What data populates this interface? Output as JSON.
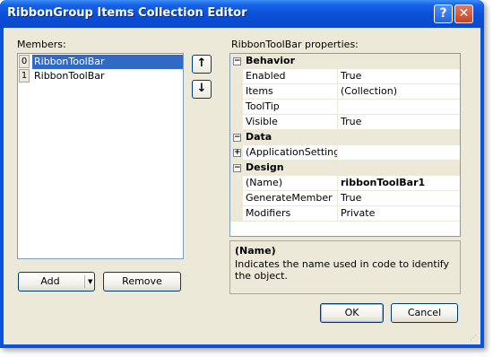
{
  "window": {
    "title": "RibbonGroup Items Collection Editor"
  },
  "members": {
    "label": "Members:",
    "items": [
      {
        "index": "0",
        "name": "RibbonToolBar"
      },
      {
        "index": "1",
        "name": "RibbonToolBar"
      }
    ]
  },
  "buttons": {
    "add": "Add",
    "remove": "Remove",
    "ok": "OK",
    "cancel": "Cancel",
    "move_up": "↑",
    "move_down": "↓",
    "help": "?",
    "close": "✕",
    "dropdown": "▼"
  },
  "properties": {
    "label": "RibbonToolBar properties:",
    "categories": [
      {
        "name": "Behavior",
        "rows": [
          {
            "name": "Enabled",
            "value": "True"
          },
          {
            "name": "Items",
            "value": "(Collection)"
          },
          {
            "name": "ToolTip",
            "value": ""
          },
          {
            "name": "Visible",
            "value": "True"
          }
        ]
      },
      {
        "name": "Data",
        "rows": [
          {
            "name": "(ApplicationSettings)",
            "value": ""
          }
        ]
      },
      {
        "name": "Design",
        "rows": [
          {
            "name": "(Name)",
            "value": "ribbonToolBar1"
          },
          {
            "name": "GenerateMember",
            "value": "True"
          },
          {
            "name": "Modifiers",
            "value": "Private"
          }
        ]
      }
    ],
    "toggle_minus": "−",
    "toggle_plus": "+"
  },
  "description": {
    "title": "(Name)",
    "text": "Indicates the name used in code to identify the object."
  }
}
